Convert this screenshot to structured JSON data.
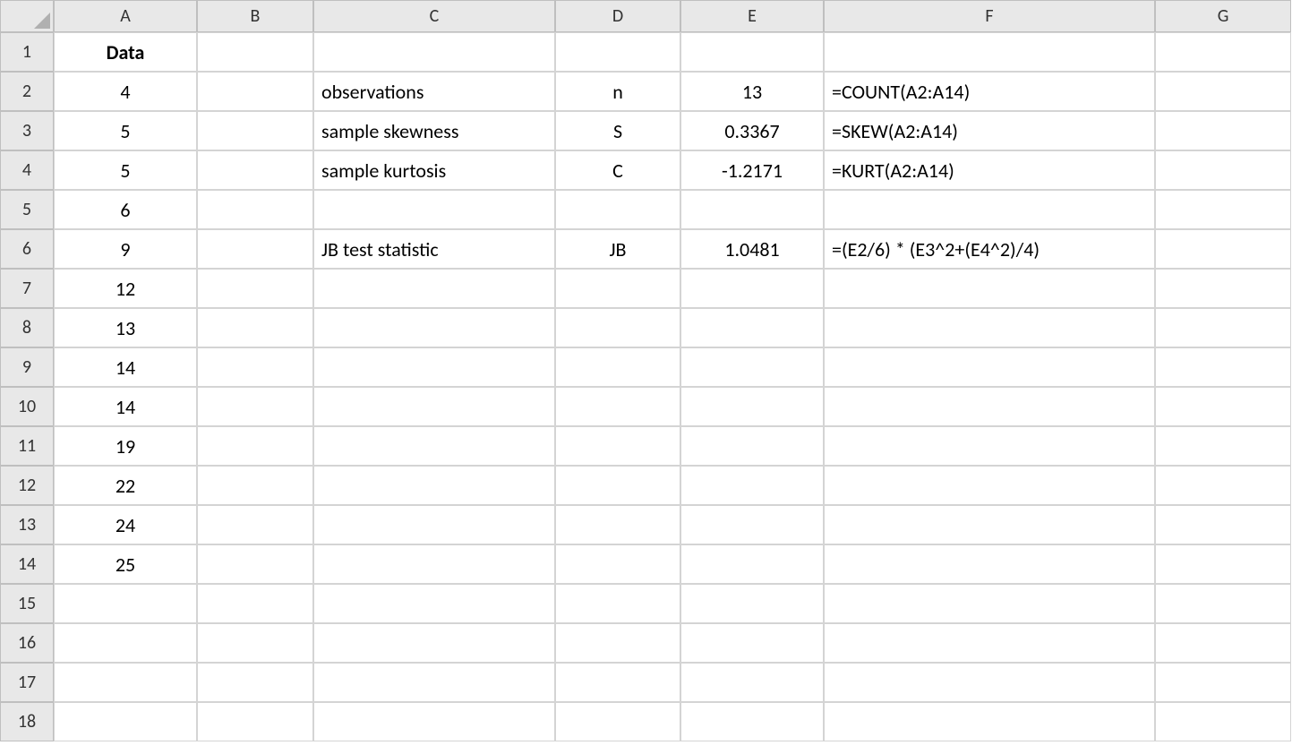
{
  "columns": [
    "A",
    "B",
    "C",
    "D",
    "E",
    "F",
    "G"
  ],
  "rows": [
    "1",
    "2",
    "3",
    "4",
    "5",
    "6",
    "7",
    "8",
    "9",
    "10",
    "11",
    "12",
    "13",
    "14",
    "15",
    "16",
    "17",
    "18"
  ],
  "cells": {
    "A1": "Data",
    "A2": "4",
    "A3": "5",
    "A4": "5",
    "A5": "6",
    "A6": "9",
    "A7": "12",
    "A8": "13",
    "A9": "14",
    "A10": "14",
    "A11": "19",
    "A12": "22",
    "A13": "24",
    "A14": "25",
    "C2": "observations",
    "C3": "sample skewness",
    "C4": "sample kurtosis",
    "C6": "JB test statistic",
    "D2": "n",
    "D3": "S",
    "D4": "C",
    "D6": "JB",
    "E2": "13",
    "E3": "0.3367",
    "E4": "-1.2171",
    "E6": "1.0481",
    "F2": "=COUNT(A2:A14)",
    "F3": "=SKEW(A2:A14)",
    "F4": "=KURT(A2:A14)",
    "F6": "=(E2/6) * (E3^2+(E4^2)/4)"
  }
}
